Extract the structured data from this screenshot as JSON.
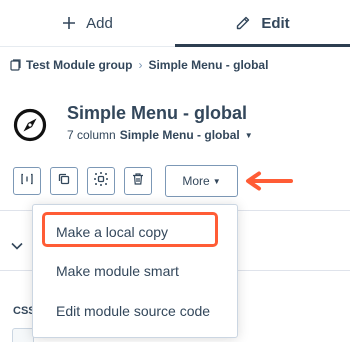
{
  "tabs": {
    "add": {
      "label": "Add",
      "icon": "plus-icon"
    },
    "edit": {
      "label": "Edit",
      "icon": "pencil-icon",
      "active": true
    }
  },
  "breadcrumb": {
    "parent": "Test Module group",
    "separator": "›",
    "current": "Simple Menu - global"
  },
  "module": {
    "title": "Simple Menu - global",
    "layout_prefix": "7 column",
    "layout_name": "Simple Menu - global",
    "icon": "compass-icon"
  },
  "toolbar": {
    "buttons": [
      {
        "icon": "column-layout-icon"
      },
      {
        "icon": "duplicate-icon"
      },
      {
        "icon": "smart-module-icon"
      },
      {
        "icon": "delete-icon"
      }
    ],
    "more_label": "More"
  },
  "dropdown": {
    "items": [
      {
        "label": "Make a local copy",
        "highlighted": true
      },
      {
        "label": "Make module smart"
      },
      {
        "label": "Edit module source code"
      }
    ]
  },
  "panel": {
    "css_label": "CSS"
  },
  "colors": {
    "accent": "#ff5c35",
    "text": "#33475b",
    "border": "#7c98b6"
  }
}
